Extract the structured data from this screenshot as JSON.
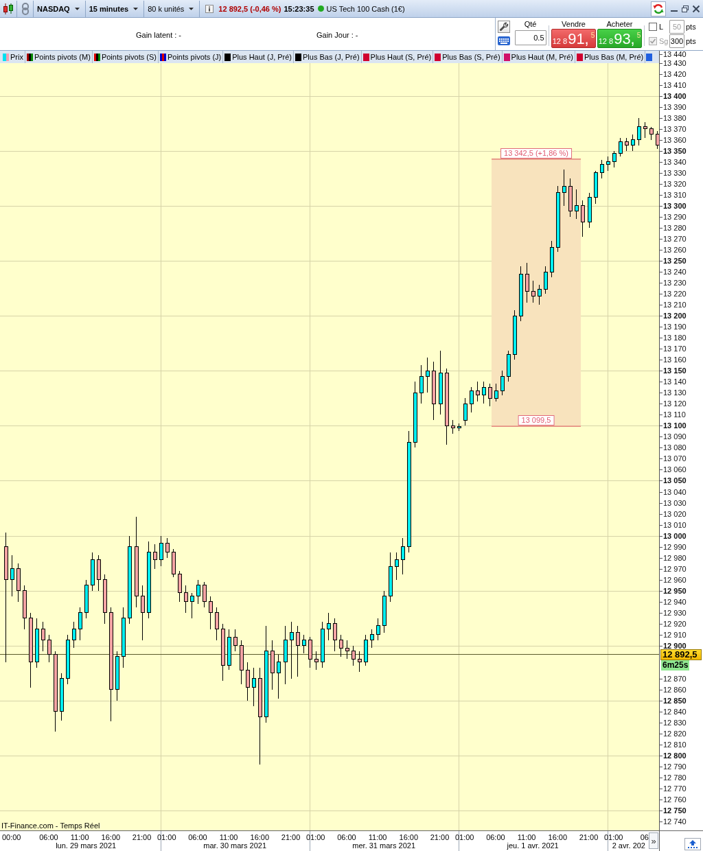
{
  "toolbar": {
    "exchange": "NASDAQ",
    "timeframe": "15 minutes",
    "lot_size": "80 k unités",
    "quote": "12 892,5 (-0,46 %)",
    "time": "15:23:35",
    "instrument": "US Tech 100 Cash (1€)",
    "market_open": true
  },
  "gains": [
    "Gain latent : -",
    "Gain Jour : -"
  ],
  "order": {
    "quantity": {
      "label": "Qté",
      "value": "0.5"
    },
    "sell": {
      "label": "Vendre",
      "price_small": "12 8",
      "price_large": "91,",
      "price_sup": "5"
    },
    "buy": {
      "label": "Acheter",
      "price_small": "12 8",
      "price_large": "93,",
      "price_sup": "5"
    },
    "options": [
      {
        "label": "L",
        "checked": false,
        "disabled": false
      },
      {
        "label": "Sg",
        "checked": true,
        "disabled": true
      }
    ],
    "distances": [
      {
        "value": "50",
        "unit": "pts",
        "disabled": true
      },
      {
        "value": "300",
        "unit": "pts",
        "disabled": false
      }
    ]
  },
  "legend": [
    {
      "label": "Prix",
      "swatch": [
        {
          "color": "#00e0f0"
        },
        {
          "color": "#f4a0b0"
        }
      ]
    },
    {
      "label": "Points pivots (M)",
      "swatch": [
        {
          "color": "#aa0000"
        },
        {
          "color": "#000000"
        },
        {
          "color": "#008800"
        }
      ]
    },
    {
      "label": "Points pivots (S)",
      "swatch": [
        {
          "color": "#dd0000"
        },
        {
          "color": "#000000"
        },
        {
          "color": "#008800"
        }
      ]
    },
    {
      "label": "Points pivots (J)",
      "swatch": [
        {
          "color": "#0000cc"
        },
        {
          "color": "#dd0000"
        },
        {
          "color": "#0000cc"
        }
      ]
    },
    {
      "label": "Plus Haut (J, Pré)",
      "swatch": [
        {
          "color": "#000000"
        }
      ]
    },
    {
      "label": "Plus Bas (J, Pré)",
      "swatch": [
        {
          "color": "#000000"
        }
      ]
    },
    {
      "label": "Plus Haut (S, Pré)",
      "swatch": [
        {
          "color": "#d00030"
        }
      ]
    },
    {
      "label": "Plus Bas (S, Pré)",
      "swatch": [
        {
          "color": "#d00030"
        }
      ]
    },
    {
      "label": "Plus Haut (M, Pré)",
      "swatch": [
        {
          "color": "#d0106a"
        }
      ]
    },
    {
      "label": "Plus Bas (M, Pré)",
      "swatch": [
        {
          "color": "#d00030"
        }
      ]
    },
    {
      "swatch": [
        {
          "color": "#2060e0"
        }
      ]
    }
  ],
  "chart": {
    "source": "IT-Finance.com - Temps Réel",
    "scroll_button": "»",
    "countdown": "6m25s",
    "dates": [
      "lun. 29 mars 2021",
      "mar. 30 mars 2021",
      "mer. 31 mars 2021",
      "jeu. 1 avr. 2021",
      "2 avr. 202"
    ],
    "chart_data": {
      "type": "candlestick",
      "grid": true,
      "xlim": [
        "2021-03-28T22:09",
        "2021-04-02T15:25"
      ],
      "ylim": [
        12732,
        13441
      ],
      "x": [
        "2021-03-28T23:00",
        "2021-03-29T00:00",
        "2021-03-29T01:00",
        "2021-03-29T02:00",
        "2021-03-29T03:00",
        "2021-03-29T04:00",
        "2021-03-29T05:00",
        "2021-03-29T06:00",
        "2021-03-29T07:00",
        "2021-03-29T08:00",
        "2021-03-29T09:00",
        "2021-03-29T10:00",
        "2021-03-29T11:00",
        "2021-03-29T12:00",
        "2021-03-29T13:00",
        "2021-03-29T14:00",
        "2021-03-29T15:00",
        "2021-03-29T16:00",
        "2021-03-29T17:00",
        "2021-03-29T18:00",
        "2021-03-29T19:00",
        "2021-03-29T20:00",
        "2021-03-29T21:00",
        "2021-03-29T22:00",
        "2021-03-29T23:00",
        "2021-03-30T00:00",
        "2021-03-30T01:00",
        "2021-03-30T02:00",
        "2021-03-30T03:00",
        "2021-03-30T04:00",
        "2021-03-30T05:00",
        "2021-03-30T06:00",
        "2021-03-30T07:00",
        "2021-03-30T08:00",
        "2021-03-30T09:00",
        "2021-03-30T10:00",
        "2021-03-30T11:00",
        "2021-03-30T12:00",
        "2021-03-30T13:00",
        "2021-03-30T14:00",
        "2021-03-30T15:00",
        "2021-03-30T16:00",
        "2021-03-30T17:00",
        "2021-03-30T18:00",
        "2021-03-30T19:00",
        "2021-03-30T20:00",
        "2021-03-30T21:00",
        "2021-03-30T22:00",
        "2021-03-30T23:00",
        "2021-03-31T00:00",
        "2021-03-31T01:00",
        "2021-03-31T02:00",
        "2021-03-31T03:00",
        "2021-03-31T04:00",
        "2021-03-31T05:00",
        "2021-03-31T06:00",
        "2021-03-31T07:00",
        "2021-03-31T08:00",
        "2021-03-31T09:00",
        "2021-03-31T10:00",
        "2021-03-31T11:00",
        "2021-03-31T12:00",
        "2021-03-31T13:00",
        "2021-03-31T14:00",
        "2021-03-31T15:00",
        "2021-03-31T16:00",
        "2021-03-31T17:00",
        "2021-03-31T18:00",
        "2021-03-31T19:00",
        "2021-03-31T20:00",
        "2021-03-31T21:00",
        "2021-03-31T22:00",
        "2021-03-31T23:00",
        "2021-04-01T00:00",
        "2021-04-01T01:00",
        "2021-04-01T02:00",
        "2021-04-01T03:00",
        "2021-04-01T04:00",
        "2021-04-01T05:00",
        "2021-04-01T06:00",
        "2021-04-01T07:00",
        "2021-04-01T08:00",
        "2021-04-01T09:00",
        "2021-04-01T10:00",
        "2021-04-01T11:00",
        "2021-04-01T12:00",
        "2021-04-01T13:00",
        "2021-04-01T14:00",
        "2021-04-01T15:00",
        "2021-04-01T16:00",
        "2021-04-01T17:00",
        "2021-04-01T18:00",
        "2021-04-01T19:00",
        "2021-04-01T20:00",
        "2021-04-01T21:00",
        "2021-04-01T22:00",
        "2021-04-01T23:00",
        "2021-04-02T00:00",
        "2021-04-02T01:00",
        "2021-04-02T02:00",
        "2021-04-02T03:00",
        "2021-04-02T04:00",
        "2021-04-02T05:00",
        "2021-04-02T06:00",
        "2021-04-02T07:00",
        "2021-04-02T08:00"
      ],
      "ohlc": [
        [
          12990,
          13003,
          12885,
          12960
        ],
        [
          12960,
          12982,
          12945,
          12970
        ],
        [
          12970,
          12975,
          12940,
          12950
        ],
        [
          12950,
          12955,
          12915,
          12925
        ],
        [
          12925,
          12930,
          12862,
          12885
        ],
        [
          12885,
          12925,
          12880,
          12915
        ],
        [
          12915,
          12922,
          12895,
          12905
        ],
        [
          12905,
          12910,
          12885,
          12892
        ],
        [
          12892,
          12895,
          12822,
          12840
        ],
        [
          12840,
          12875,
          12832,
          12870
        ],
        [
          12870,
          12910,
          12865,
          12905
        ],
        [
          12905,
          12922,
          12898,
          12915
        ],
        [
          12915,
          12935,
          12905,
          12930
        ],
        [
          12930,
          12960,
          12925,
          12955
        ],
        [
          12955,
          12985,
          12950,
          12978
        ],
        [
          12978,
          12982,
          12950,
          12960
        ],
        [
          12960,
          12965,
          12920,
          12930
        ],
        [
          12930,
          12935,
          12831,
          12860
        ],
        [
          12860,
          12895,
          12850,
          12890
        ],
        [
          12890,
          12935,
          12880,
          12925
        ],
        [
          12925,
          13000,
          12920,
          12990
        ],
        [
          12990,
          13017,
          12935,
          12945
        ],
        [
          12945,
          12955,
          12905,
          12930
        ],
        [
          12930,
          12995,
          12925,
          12985
        ],
        [
          12985,
          12992,
          12970,
          12978
        ],
        [
          12978,
          13000,
          12972,
          12993
        ],
        [
          12993,
          12998,
          12980,
          12985
        ],
        [
          12985,
          12988,
          12962,
          12965
        ],
        [
          12965,
          12968,
          12940,
          12948
        ],
        [
          12948,
          12955,
          12930,
          12940
        ],
        [
          12940,
          12948,
          12925,
          12945
        ],
        [
          12945,
          12960,
          12938,
          12955
        ],
        [
          12955,
          12958,
          12935,
          12940
        ],
        [
          12940,
          12945,
          12915,
          12930
        ],
        [
          12930,
          12935,
          12905,
          12915
        ],
        [
          12915,
          12920,
          12868,
          12882
        ],
        [
          12882,
          12915,
          12878,
          12908
        ],
        [
          12908,
          12915,
          12895,
          12900
        ],
        [
          12900,
          12905,
          12865,
          12878
        ],
        [
          12878,
          12885,
          12850,
          12862
        ],
        [
          12862,
          12880,
          12845,
          12870
        ],
        [
          12870,
          12880,
          12792,
          12835
        ],
        [
          12835,
          12918,
          12830,
          12895
        ],
        [
          12895,
          12905,
          12860,
          12875
        ],
        [
          12875,
          12892,
          12852,
          12885
        ],
        [
          12885,
          12918,
          12865,
          12905
        ],
        [
          12905,
          12922,
          12870,
          12912
        ],
        [
          12912,
          12918,
          12872,
          12900
        ],
        [
          12900,
          12910,
          12893,
          12905
        ],
        [
          12905,
          12908,
          12880,
          12888
        ],
        [
          12888,
          12895,
          12878,
          12885
        ],
        [
          12885,
          12922,
          12880,
          12915
        ],
        [
          12915,
          12930,
          12905,
          12920
        ],
        [
          12920,
          12925,
          12895,
          12905
        ],
        [
          12905,
          12910,
          12890,
          12898
        ],
        [
          12898,
          12905,
          12888,
          12895
        ],
        [
          12895,
          12900,
          12882,
          12888
        ],
        [
          12888,
          12895,
          12876,
          12885
        ],
        [
          12885,
          12910,
          12882,
          12905
        ],
        [
          12905,
          12915,
          12898,
          12910
        ],
        [
          12910,
          12925,
          12905,
          12918
        ],
        [
          12918,
          12950,
          12912,
          12945
        ],
        [
          12945,
          12985,
          12940,
          12972
        ],
        [
          12972,
          12985,
          12960,
          12978
        ],
        [
          12978,
          12998,
          12965,
          12990
        ],
        [
          12990,
          13095,
          12985,
          13085
        ],
        [
          13085,
          13140,
          13080,
          13130
        ],
        [
          13130,
          13155,
          13120,
          13145
        ],
        [
          13145,
          13162,
          13130,
          13150
        ],
        [
          13150,
          13158,
          13105,
          13120
        ],
        [
          13120,
          13168,
          13110,
          13148
        ],
        [
          13148,
          13152,
          13083,
          13100
        ],
        [
          13100,
          13105,
          13093,
          13098
        ],
        [
          13098,
          13102,
          13095,
          13099
        ],
        [
          13105,
          13125,
          13100,
          13120
        ],
        [
          13120,
          13135,
          13112,
          13132
        ],
        [
          13132,
          13140,
          13122,
          13128
        ],
        [
          13128,
          13140,
          13120,
          13135
        ],
        [
          13135,
          13138,
          13118,
          13125
        ],
        [
          13125,
          13138,
          13122,
          13132
        ],
        [
          13132,
          13150,
          13128,
          13145
        ],
        [
          13145,
          13168,
          13140,
          13165
        ],
        [
          13165,
          13205,
          13160,
          13200
        ],
        [
          13200,
          13245,
          13195,
          13238
        ],
        [
          13238,
          13248,
          13212,
          13222
        ],
        [
          13222,
          13232,
          13212,
          13218
        ],
        [
          13218,
          13228,
          13210,
          13224
        ],
        [
          13224,
          13245,
          13220,
          13240
        ],
        [
          13240,
          13268,
          13235,
          13262
        ],
        [
          13262,
          13318,
          13258,
          13312
        ],
        [
          13312,
          13333,
          13300,
          13318
        ],
        [
          13318,
          13325,
          13290,
          13295
        ],
        [
          13295,
          13315,
          13288,
          13300
        ],
        [
          13300,
          13305,
          13272,
          13285
        ],
        [
          13285,
          13312,
          13280,
          13308
        ],
        [
          13308,
          13332,
          13302,
          13330
        ],
        [
          13330,
          13342,
          13325,
          13338
        ],
        [
          13338,
          13345,
          13332,
          13340
        ],
        [
          13340,
          13350,
          13335,
          13348
        ],
        [
          13348,
          13362,
          13345,
          13358
        ],
        [
          13358,
          13362,
          13350,
          13355
        ],
        [
          13355,
          13365,
          13350,
          13360
        ],
        [
          13360,
          13380,
          13355,
          13372
        ],
        [
          13372,
          13376,
          13362,
          13370
        ],
        [
          13370,
          13372,
          13360,
          13365
        ],
        [
          13365,
          13368,
          13352,
          13355
        ]
      ],
      "xticks": [
        {
          "value": "2021-03-29T00:00",
          "label": "00:00"
        },
        {
          "value": "2021-03-29T06:00",
          "label": "06:00"
        },
        {
          "value": "2021-03-29T11:00",
          "label": "11:00"
        },
        {
          "value": "2021-03-29T16:00",
          "label": "16:00"
        },
        {
          "value": "2021-03-29T21:00",
          "label": "21:00"
        },
        {
          "value": "2021-03-30T01:00",
          "label": "01:00"
        },
        {
          "value": "2021-03-30T06:00",
          "label": "06:00"
        },
        {
          "value": "2021-03-30T11:00",
          "label": "11:00"
        },
        {
          "value": "2021-03-30T16:00",
          "label": "16:00"
        },
        {
          "value": "2021-03-30T21:00",
          "label": "21:00"
        },
        {
          "value": "2021-03-31T01:00",
          "label": "01:00"
        },
        {
          "value": "2021-03-31T06:00",
          "label": "06:00"
        },
        {
          "value": "2021-03-31T11:00",
          "label": "11:00"
        },
        {
          "value": "2021-03-31T16:00",
          "label": "16:00"
        },
        {
          "value": "2021-03-31T21:00",
          "label": "21:00"
        },
        {
          "value": "2021-04-01T01:00",
          "label": "01:00"
        },
        {
          "value": "2021-04-01T06:00",
          "label": "06:00"
        },
        {
          "value": "2021-04-01T11:00",
          "label": "11:00"
        },
        {
          "value": "2021-04-01T16:00",
          "label": "16:00"
        },
        {
          "value": "2021-04-01T21:00",
          "label": "21:00"
        },
        {
          "value": "2021-04-02T01:00",
          "label": "01:00"
        },
        {
          "value": "2021-04-02T06:00",
          "label": "06"
        }
      ],
      "yticks": [
        {
          "value": 13440,
          "label": "13 440"
        },
        {
          "value": 13430,
          "label": "13 430"
        },
        {
          "value": 13420,
          "label": "13 420"
        },
        {
          "value": 13410,
          "label": "13 410"
        },
        {
          "value": 13400,
          "label": "13 400"
        },
        {
          "value": 13390,
          "label": "13 390"
        },
        {
          "value": 13380,
          "label": "13 380"
        },
        {
          "value": 13370,
          "label": "13 370"
        },
        {
          "value": 13360,
          "label": "13 360"
        },
        {
          "value": 13350,
          "label": "13 350"
        },
        {
          "value": 13340,
          "label": "13 340"
        },
        {
          "value": 13330,
          "label": "13 330"
        },
        {
          "value": 13320,
          "label": "13 320"
        },
        {
          "value": 13310,
          "label": "13 310"
        },
        {
          "value": 13300,
          "label": "13 300"
        },
        {
          "value": 13290,
          "label": "13 290"
        },
        {
          "value": 13280,
          "label": "13 280"
        },
        {
          "value": 13270,
          "label": "13 270"
        },
        {
          "value": 13260,
          "label": "13 260"
        },
        {
          "value": 13250,
          "label": "13 250"
        },
        {
          "value": 13240,
          "label": "13 240"
        },
        {
          "value": 13230,
          "label": "13 230"
        },
        {
          "value": 13220,
          "label": "13 220"
        },
        {
          "value": 13210,
          "label": "13 210"
        },
        {
          "value": 13200,
          "label": "13 200"
        },
        {
          "value": 13190,
          "label": "13 190"
        },
        {
          "value": 13180,
          "label": "13 180"
        },
        {
          "value": 13170,
          "label": "13 170"
        },
        {
          "value": 13160,
          "label": "13 160"
        },
        {
          "value": 13150,
          "label": "13 150"
        },
        {
          "value": 13140,
          "label": "13 140"
        },
        {
          "value": 13130,
          "label": "13 130"
        },
        {
          "value": 13120,
          "label": "13 120"
        },
        {
          "value": 13110,
          "label": "13 110"
        },
        {
          "value": 13100,
          "label": "13 100"
        },
        {
          "value": 13090,
          "label": "13 090"
        },
        {
          "value": 13080,
          "label": "13 080"
        },
        {
          "value": 13070,
          "label": "13 070"
        },
        {
          "value": 13060,
          "label": "13 060"
        },
        {
          "value": 13050,
          "label": "13 050"
        },
        {
          "value": 13040,
          "label": "13 040"
        },
        {
          "value": 13030,
          "label": "13 030"
        },
        {
          "value": 13020,
          "label": "13 020"
        },
        {
          "value": 13010,
          "label": "13 010"
        },
        {
          "value": 13000,
          "label": "13 000"
        },
        {
          "value": 12990,
          "label": "12 990"
        },
        {
          "value": 12980,
          "label": "12 980"
        },
        {
          "value": 12970,
          "label": "12 970"
        },
        {
          "value": 12960,
          "label": "12 960"
        },
        {
          "value": 12950,
          "label": "12 950"
        },
        {
          "value": 12940,
          "label": "12 940"
        },
        {
          "value": 12930,
          "label": "12 930"
        },
        {
          "value": 12920,
          "label": "12 920"
        },
        {
          "value": 12910,
          "label": "12 910"
        },
        {
          "value": 12900,
          "label": "12 900"
        },
        {
          "value": 12870,
          "label": "12 870"
        },
        {
          "value": 12860,
          "label": "12 860"
        },
        {
          "value": 12850,
          "label": "12 850"
        },
        {
          "value": 12840,
          "label": "12 840"
        },
        {
          "value": 12830,
          "label": "12 830"
        },
        {
          "value": 12820,
          "label": "12 820"
        },
        {
          "value": 12810,
          "label": "12 810"
        },
        {
          "value": 12800,
          "label": "12 800"
        },
        {
          "value": 12790,
          "label": "12 790"
        },
        {
          "value": 12780,
          "label": "12 780"
        },
        {
          "value": 12770,
          "label": "12 770"
        },
        {
          "value": 12760,
          "label": "12 760"
        },
        {
          "value": 12750,
          "label": "12 750"
        },
        {
          "value": 12740,
          "label": "12 740"
        }
      ],
      "bands": [
        {
          "axis": "x",
          "from": "2021-04-01T05:21",
          "to": "2021-04-01T19:44"
        }
      ],
      "annotations": [
        {
          "text": "13 342,5 (+1,86 %)",
          "x": "2021-04-01T12:32",
          "y": 13342.5
        },
        {
          "text": "13 099,5",
          "x": "2021-04-01T12:32",
          "y": 13099.5
        }
      ],
      "ref_lines": [
        {
          "axis": "y",
          "value": 12892.5,
          "label": "12 892,5"
        }
      ]
    }
  }
}
